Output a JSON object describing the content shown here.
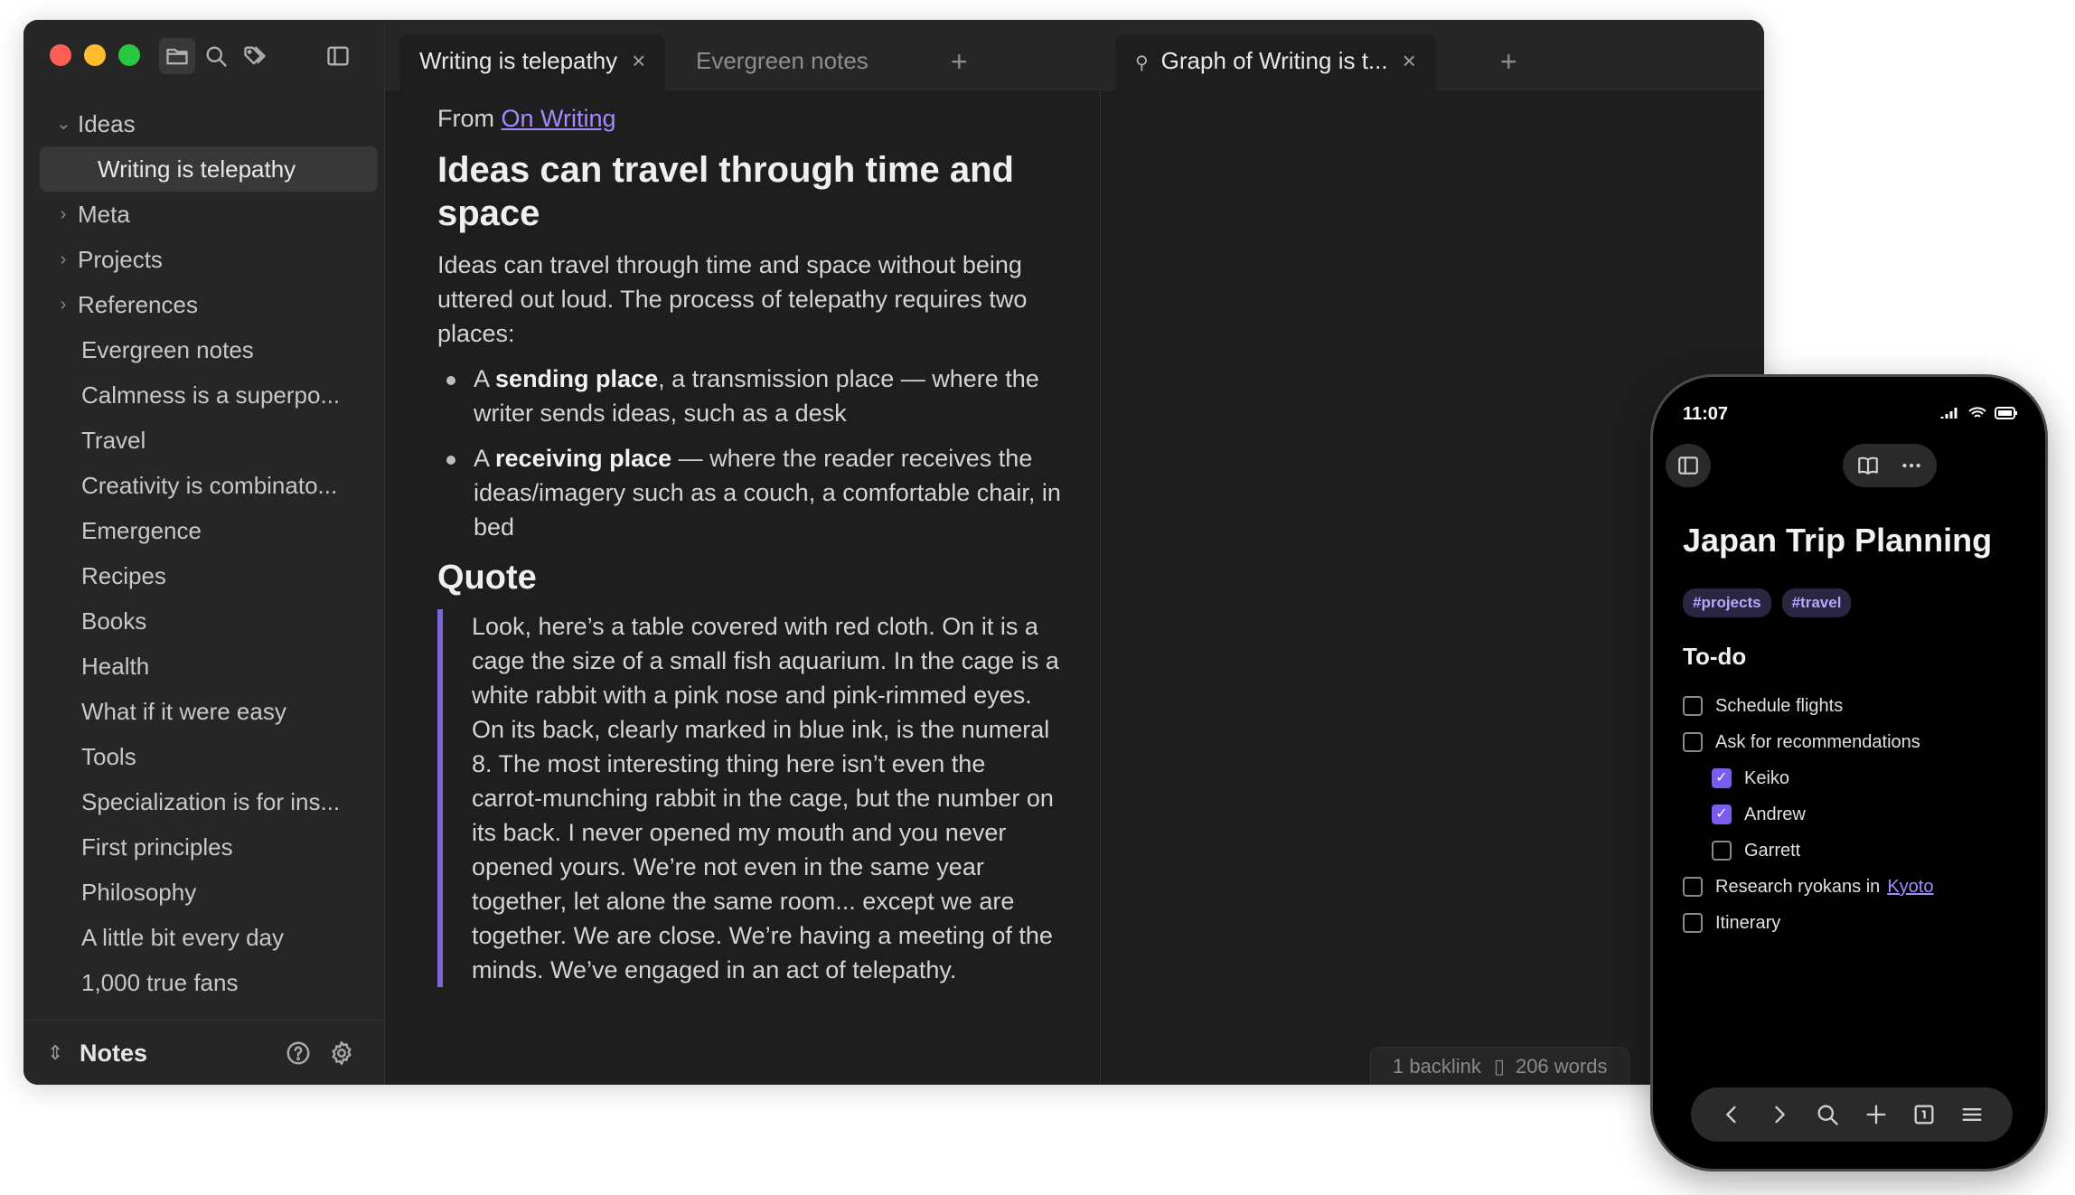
{
  "sidebar": {
    "tree": [
      {
        "label": "Ideas",
        "type": "folder",
        "expanded": true
      },
      {
        "label": "Writing is telepathy",
        "type": "child",
        "selected": true
      },
      {
        "label": "Meta",
        "type": "folder"
      },
      {
        "label": "Projects",
        "type": "folder"
      },
      {
        "label": "References",
        "type": "folder"
      },
      {
        "label": "Evergreen notes",
        "type": "file"
      },
      {
        "label": "Calmness is a superpo...",
        "type": "file"
      },
      {
        "label": "Travel",
        "type": "file"
      },
      {
        "label": "Creativity is combinato...",
        "type": "file"
      },
      {
        "label": "Emergence",
        "type": "file"
      },
      {
        "label": "Recipes",
        "type": "file"
      },
      {
        "label": "Books",
        "type": "file"
      },
      {
        "label": "Health",
        "type": "file"
      },
      {
        "label": "What if it were easy",
        "type": "file"
      },
      {
        "label": "Tools",
        "type": "file"
      },
      {
        "label": "Specialization is for ins...",
        "type": "file"
      },
      {
        "label": "First principles",
        "type": "file"
      },
      {
        "label": "Philosophy",
        "type": "file"
      },
      {
        "label": "A little bit every day",
        "type": "file"
      },
      {
        "label": "1,000 true fans",
        "type": "file"
      }
    ],
    "vault_name": "Notes"
  },
  "editor": {
    "tabs": [
      {
        "label": "Writing is telepathy",
        "active": true
      },
      {
        "label": "Evergreen notes",
        "active": false
      }
    ],
    "from_prefix": "From",
    "from_link": "On Writing",
    "heading1": "Ideas can travel through time and space",
    "paragraph": "Ideas can travel through time and space without being uttered out loud. The process of telepathy requires two places:",
    "bullets": [
      {
        "prefix": "A ",
        "bold": "sending place",
        "rest": ", a transmission place — where the writer sends ideas, such as a desk"
      },
      {
        "prefix": "A ",
        "bold": "receiving place",
        "rest": " — where the reader receives the ideas/imagery such as a couch, a comfortable chair, in bed"
      }
    ],
    "heading2": "Quote",
    "quote": "Look, here’s a table covered with red cloth. On it is a cage the size of a small fish aquarium. In the cage is a white rabbit with a pink nose and pink-rimmed eyes. On its back, clearly marked in blue ink, is the numeral 8. The most interesting thing here isn’t even the carrot-munching rabbit in the cage, but the number on its back. I never opened my mouth and you never opened yours. We’re not even in the same year together, let alone the same room... except we are together. We are close. We’re having a meeting of the minds. We’ve engaged in an act of telepathy."
  },
  "graph_pane": {
    "tab_label": "Graph of Writing is t...",
    "status_backlinks": "1 backlink",
    "status_words": "206 words"
  },
  "phone": {
    "time": "11:07",
    "title": "Japan Trip Planning",
    "tags": [
      "#projects",
      "#travel"
    ],
    "todo_heading": "To-do",
    "todos": [
      {
        "label": "Schedule flights",
        "checked": false,
        "level": 0
      },
      {
        "label": "Ask for recommendations",
        "checked": false,
        "level": 0
      },
      {
        "label": "Keiko",
        "checked": true,
        "level": 1
      },
      {
        "label": "Andrew",
        "checked": true,
        "level": 1
      },
      {
        "label": "Garrett",
        "checked": false,
        "level": 1
      },
      {
        "label": "Research ryokans in",
        "link": "Kyoto",
        "checked": false,
        "level": 0
      },
      {
        "label": "Itinerary",
        "checked": false,
        "level": 0
      }
    ]
  },
  "colors": {
    "accent": "#7b5cf0",
    "link": "#a38aff",
    "background": "#1e1e1e",
    "sidebar": "#262626"
  }
}
